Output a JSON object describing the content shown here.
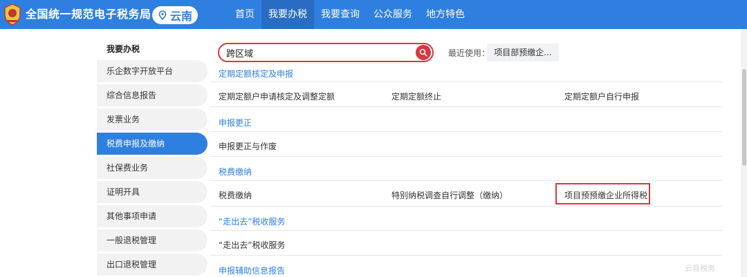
{
  "header": {
    "site_title": "全国统一规范电子税务局",
    "region": "云南",
    "nav": [
      {
        "label": "首页"
      },
      {
        "label": "我要办税"
      },
      {
        "label": "我要查询"
      },
      {
        "label": "公众服务"
      },
      {
        "label": "地方特色"
      }
    ],
    "active_nav_index": 1,
    "accent_color": "#2f7fe0"
  },
  "sidebar": {
    "title": "我要办税",
    "items": [
      {
        "label": "乐企数字开放平台"
      },
      {
        "label": "综合信息报告"
      },
      {
        "label": "发票业务"
      },
      {
        "label": "税费申报及缴纳"
      },
      {
        "label": "社保费业务"
      },
      {
        "label": "证明开具"
      },
      {
        "label": "其他事项申请"
      },
      {
        "label": "一般退税管理"
      },
      {
        "label": "出口退税管理"
      }
    ],
    "active_index": 3
  },
  "search": {
    "value": "跨区域",
    "border_color": "#d9363e"
  },
  "recent": {
    "label": "最近使用：",
    "chip": "项目部预缴企..."
  },
  "sections": [
    {
      "title": "定期定额核定及申报",
      "items": [
        "定期定额户申请核定及调整定额",
        "定期定额终止",
        "定期定额户自行申报"
      ]
    },
    {
      "title": "申报更正",
      "items": [
        "申报更正与作废"
      ]
    },
    {
      "title": "税费缴纳",
      "items": [
        "税费缴纳",
        "特别纳税调查自行调整（缴纳）",
        "项目预预缴企业所得税"
      ]
    },
    {
      "title": "“走出去”税收服务",
      "items": [
        "“走出去”税收服务"
      ]
    },
    {
      "title": "申报辅助信息报告",
      "items": []
    }
  ],
  "watermark": "云县税务"
}
